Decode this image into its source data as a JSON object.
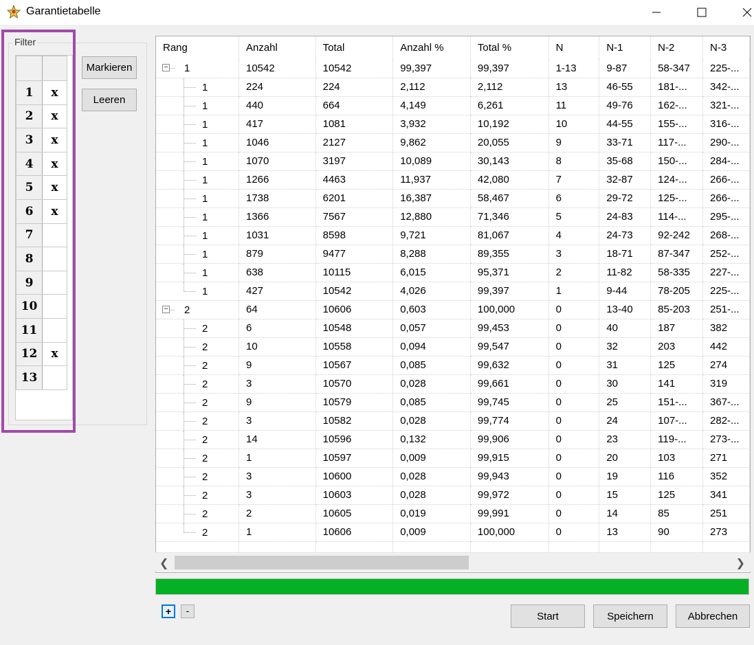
{
  "window": {
    "title": "Garantietabelle"
  },
  "filter": {
    "legend": "Filter",
    "rows": [
      {
        "n": "1",
        "mark": "x"
      },
      {
        "n": "2",
        "mark": "x"
      },
      {
        "n": "3",
        "mark": "x"
      },
      {
        "n": "4",
        "mark": "x"
      },
      {
        "n": "5",
        "mark": "x"
      },
      {
        "n": "6",
        "mark": "x"
      },
      {
        "n": "7",
        "mark": ""
      },
      {
        "n": "8",
        "mark": ""
      },
      {
        "n": "9",
        "mark": ""
      },
      {
        "n": "10",
        "mark": ""
      },
      {
        "n": "11",
        "mark": ""
      },
      {
        "n": "12",
        "mark": "x"
      },
      {
        "n": "13",
        "mark": ""
      }
    ],
    "mark_button": "Markieren",
    "clear_button": "Leeren"
  },
  "table": {
    "columns": [
      "Rang",
      "Anzahl",
      "Total",
      "Anzahl %",
      "Total %",
      "N",
      "N-1",
      "N-2",
      "N-3"
    ],
    "rows": [
      {
        "level": 0,
        "cells": [
          "1",
          "10542",
          "10542",
          "99,397",
          "99,397",
          "1-13",
          "9-87",
          "58-347",
          "225-..."
        ]
      },
      {
        "level": 1,
        "cells": [
          "1",
          "224",
          "224",
          "2,112",
          "2,112",
          "13",
          "46-55",
          "181-...",
          "342-..."
        ]
      },
      {
        "level": 1,
        "cells": [
          "1",
          "440",
          "664",
          "4,149",
          "6,261",
          "11",
          "49-76",
          "162-...",
          "321-..."
        ]
      },
      {
        "level": 1,
        "cells": [
          "1",
          "417",
          "1081",
          "3,932",
          "10,192",
          "10",
          "44-55",
          "155-...",
          "316-..."
        ]
      },
      {
        "level": 1,
        "cells": [
          "1",
          "1046",
          "2127",
          "9,862",
          "20,055",
          "9",
          "33-71",
          "117-...",
          "290-..."
        ]
      },
      {
        "level": 1,
        "cells": [
          "1",
          "1070",
          "3197",
          "10,089",
          "30,143",
          "8",
          "35-68",
          "150-...",
          "284-..."
        ]
      },
      {
        "level": 1,
        "cells": [
          "1",
          "1266",
          "4463",
          "11,937",
          "42,080",
          "7",
          "32-87",
          "124-...",
          "266-..."
        ]
      },
      {
        "level": 1,
        "cells": [
          "1",
          "1738",
          "6201",
          "16,387",
          "58,467",
          "6",
          "29-72",
          "125-...",
          "266-..."
        ]
      },
      {
        "level": 1,
        "cells": [
          "1",
          "1366",
          "7567",
          "12,880",
          "71,346",
          "5",
          "24-83",
          "114-...",
          "295-..."
        ]
      },
      {
        "level": 1,
        "cells": [
          "1",
          "1031",
          "8598",
          "9,721",
          "81,067",
          "4",
          "24-73",
          "92-242",
          "268-..."
        ]
      },
      {
        "level": 1,
        "cells": [
          "1",
          "879",
          "9477",
          "8,288",
          "89,355",
          "3",
          "18-71",
          "87-347",
          "252-..."
        ]
      },
      {
        "level": 1,
        "cells": [
          "1",
          "638",
          "10115",
          "6,015",
          "95,371",
          "2",
          "11-82",
          "58-335",
          "227-..."
        ]
      },
      {
        "level": 1,
        "last": true,
        "cells": [
          "1",
          "427",
          "10542",
          "4,026",
          "99,397",
          "1",
          "9-44",
          "78-205",
          "225-..."
        ]
      },
      {
        "level": 0,
        "cells": [
          "2",
          "64",
          "10606",
          "0,603",
          "100,000",
          "0",
          "13-40",
          "85-203",
          "251-..."
        ]
      },
      {
        "level": 1,
        "cells": [
          "2",
          "6",
          "10548",
          "0,057",
          "99,453",
          "0",
          "40",
          "187",
          "382"
        ]
      },
      {
        "level": 1,
        "cells": [
          "2",
          "10",
          "10558",
          "0,094",
          "99,547",
          "0",
          "32",
          "203",
          "442"
        ]
      },
      {
        "level": 1,
        "cells": [
          "2",
          "9",
          "10567",
          "0,085",
          "99,632",
          "0",
          "31",
          "125",
          "274"
        ]
      },
      {
        "level": 1,
        "cells": [
          "2",
          "3",
          "10570",
          "0,028",
          "99,661",
          "0",
          "30",
          "141",
          "319"
        ]
      },
      {
        "level": 1,
        "cells": [
          "2",
          "9",
          "10579",
          "0,085",
          "99,745",
          "0",
          "25",
          "151-...",
          "367-..."
        ]
      },
      {
        "level": 1,
        "cells": [
          "2",
          "3",
          "10582",
          "0,028",
          "99,774",
          "0",
          "24",
          "107-...",
          "282-..."
        ]
      },
      {
        "level": 1,
        "cells": [
          "2",
          "14",
          "10596",
          "0,132",
          "99,906",
          "0",
          "23",
          "119-...",
          "273-..."
        ]
      },
      {
        "level": 1,
        "cells": [
          "2",
          "1",
          "10597",
          "0,009",
          "99,915",
          "0",
          "20",
          "103",
          "271"
        ]
      },
      {
        "level": 1,
        "cells": [
          "2",
          "3",
          "10600",
          "0,028",
          "99,943",
          "0",
          "19",
          "116",
          "352"
        ]
      },
      {
        "level": 1,
        "cells": [
          "2",
          "3",
          "10603",
          "0,028",
          "99,972",
          "0",
          "15",
          "125",
          "341"
        ]
      },
      {
        "level": 1,
        "cells": [
          "2",
          "2",
          "10605",
          "0,019",
          "99,991",
          "0",
          "14",
          "85",
          "251"
        ]
      },
      {
        "level": 1,
        "last": true,
        "cells": [
          "2",
          "1",
          "10606",
          "0,009",
          "100,000",
          "0",
          "13",
          "90",
          "273"
        ]
      }
    ]
  },
  "progress": {
    "fraction": 1.0,
    "color": "#06b025"
  },
  "bottom": {
    "plus": "+",
    "minus": "-",
    "start": "Start",
    "save": "Speichern",
    "cancel": "Abbrechen"
  }
}
